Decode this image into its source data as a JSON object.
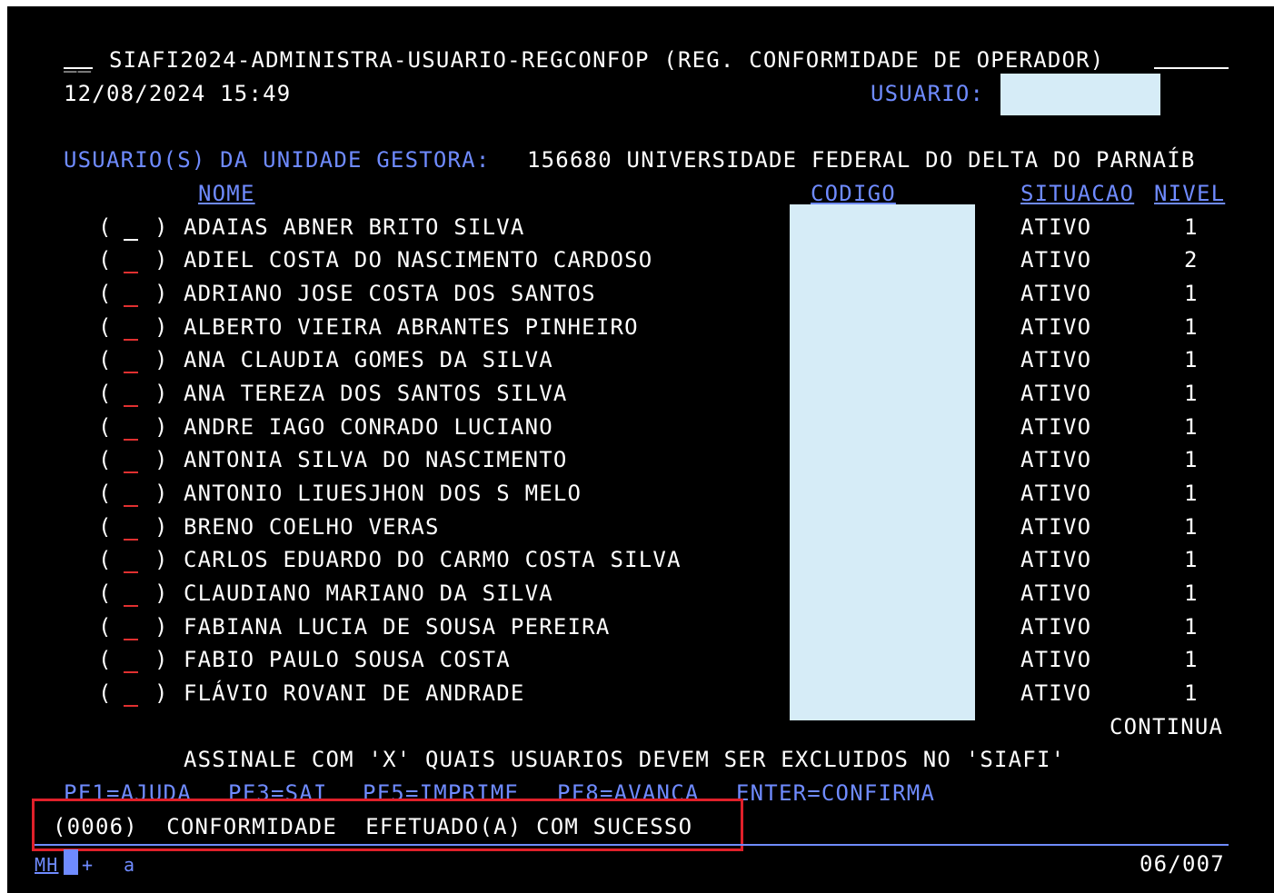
{
  "header": {
    "title_prefix": "__",
    "title": "SIAFI2024-ADMINISTRA-USUARIO-REGCONFOP (REG. CONFORMIDADE DE OPERADOR)",
    "datetime": "12/08/2024 15:49",
    "user_label": "USUARIO:",
    "user_value": ""
  },
  "unit": {
    "label": "USUARIO(S) DA UNIDADE GESTORA:",
    "value": "156680 UNIVERSIDADE FEDERAL DO DELTA DO PARNAÍB"
  },
  "columns": {
    "name": "NOME",
    "code": "CODIGO",
    "status": "SITUACAO",
    "level": "NIVEL"
  },
  "checkbox_open": "(",
  "checkbox_close": ")",
  "rows": [
    {
      "name": "ADAIAS ABNER BRITO SILVA",
      "status": "ATIVO",
      "level": "1"
    },
    {
      "name": "ADIEL COSTA DO NASCIMENTO CARDOSO",
      "status": "ATIVO",
      "level": "2"
    },
    {
      "name": "ADRIANO JOSE COSTA DOS SANTOS",
      "status": "ATIVO",
      "level": "1"
    },
    {
      "name": "ALBERTO VIEIRA ABRANTES PINHEIRO",
      "status": "ATIVO",
      "level": "1"
    },
    {
      "name": "ANA CLAUDIA GOMES DA SILVA",
      "status": "ATIVO",
      "level": "1"
    },
    {
      "name": "ANA TEREZA DOS SANTOS SILVA",
      "status": "ATIVO",
      "level": "1"
    },
    {
      "name": "ANDRE IAGO CONRADO LUCIANO",
      "status": "ATIVO",
      "level": "1"
    },
    {
      "name": "ANTONIA SILVA DO NASCIMENTO",
      "status": "ATIVO",
      "level": "1"
    },
    {
      "name": "ANTONIO LIUESJHON DOS S MELO",
      "status": "ATIVO",
      "level": "1"
    },
    {
      "name": "BRENO COELHO VERAS",
      "status": "ATIVO",
      "level": "1"
    },
    {
      "name": "CARLOS EDUARDO DO CARMO COSTA SILVA",
      "status": "ATIVO",
      "level": "1"
    },
    {
      "name": "CLAUDIANO MARIANO DA SILVA",
      "status": "ATIVO",
      "level": "1"
    },
    {
      "name": "FABIANA LUCIA DE SOUSA PEREIRA",
      "status": "ATIVO",
      "level": "1"
    },
    {
      "name": "FABIO PAULO SOUSA COSTA",
      "status": "ATIVO",
      "level": "1"
    },
    {
      "name": "FLÁVIO ROVANI DE ANDRADE",
      "status": "ATIVO",
      "level": "1"
    }
  ],
  "continua": "CONTINUA",
  "instruction": "ASSINALE COM 'X' QUAIS USUARIOS DEVEM SER EXCLUIDOS NO 'SIAFI'",
  "function_keys": {
    "pf1": "PF1=AJUDA",
    "pf3": "PF3=SAI",
    "pf5": "PF5=IMPRIME",
    "pf8": "PF8=AVANCA",
    "enter": "ENTER=CONFIRMA"
  },
  "message": "(0006)  CONFORMIDADE  EFETUADO(A) COM SUCESSO",
  "status_bar": {
    "left_label": "MH",
    "plus": "+",
    "a": "a",
    "page": "06/007"
  },
  "colors": {
    "background": "#000000",
    "text": "#ffffff",
    "label_blue": "#6f8bff",
    "field_fill": "#d6ecf7",
    "highlight_red": "#e0202a"
  }
}
